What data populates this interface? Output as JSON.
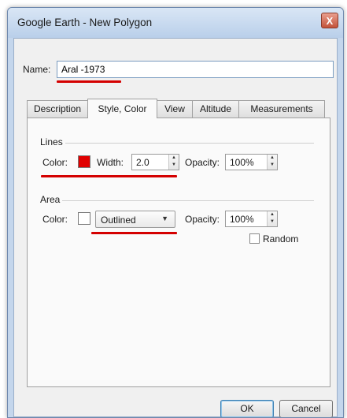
{
  "window": {
    "title": "Google Earth - New Polygon",
    "close_glyph": "X"
  },
  "name": {
    "label": "Name:",
    "value": "Aral -1973"
  },
  "tabs": [
    {
      "label": "Description",
      "active": false
    },
    {
      "label": "Style, Color",
      "active": true
    },
    {
      "label": "View",
      "active": false
    },
    {
      "label": "Altitude",
      "active": false
    },
    {
      "label": "Measurements",
      "active": false
    }
  ],
  "lines": {
    "group_label": "Lines",
    "color_label": "Color:",
    "color": "#e00000",
    "width_label": "Width:",
    "width_value": "2.0",
    "opacity_label": "Opacity:",
    "opacity_value": "100%"
  },
  "area": {
    "group_label": "Area",
    "color_label": "Color:",
    "color": "#ffffff",
    "fill_mode": "Outlined",
    "opacity_label": "Opacity:",
    "opacity_value": "100%",
    "random_label": "Random",
    "random_checked": false
  },
  "buttons": {
    "ok": "OK",
    "cancel": "Cancel"
  },
  "annotation_color": "#d40000"
}
